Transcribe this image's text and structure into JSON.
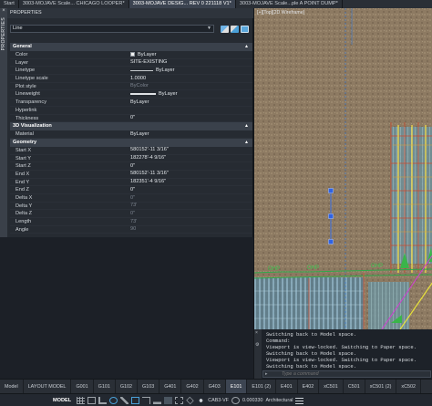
{
  "doc_tabs": [
    {
      "label": "Start",
      "active": false
    },
    {
      "label": "3003-MOJAVE Scale... CHICAGO LOOPER*",
      "active": false
    },
    {
      "label": "3003-MOJAVE DESIG... REV 0 221118 V1*",
      "active": true
    },
    {
      "label": "3003-MOJAVE Scale...ple A POINT DUMP*",
      "active": false
    }
  ],
  "palette": {
    "side_label": "PROPERTIES",
    "close_glyph": "×",
    "title": "PROPERTIES",
    "selection": "Line",
    "selection_icons": [
      "quick-select-icon",
      "select-objects-icon",
      "toggle-pickadd-icon"
    ],
    "sections": [
      {
        "name": "General",
        "rows": [
          {
            "key": "Color",
            "value": "ByLayer",
            "swatch": true
          },
          {
            "key": "Layer",
            "value": "SITE-EXISTING"
          },
          {
            "key": "Linetype",
            "value": "ByLayer",
            "line": "thin"
          },
          {
            "key": "Linetype scale",
            "value": "1.0000"
          },
          {
            "key": "Plot style",
            "value": "ByColor",
            "muted": true
          },
          {
            "key": "Lineweight",
            "value": "ByLayer",
            "line": "thick"
          },
          {
            "key": "Transparency",
            "value": "ByLayer"
          },
          {
            "key": "Hyperlink",
            "value": ""
          },
          {
            "key": "Thickness",
            "value": "0\""
          }
        ]
      },
      {
        "name": "3D Visualization",
        "rows": [
          {
            "key": "Material",
            "value": "ByLayer"
          }
        ]
      },
      {
        "name": "Geometry",
        "rows": [
          {
            "key": "Start X",
            "value": "580152'-11 3/16\""
          },
          {
            "key": "Start Y",
            "value": "182278'-4 9/16\""
          },
          {
            "key": "Start Z",
            "value": "0\""
          },
          {
            "key": "End X",
            "value": "580152'-11 3/16\""
          },
          {
            "key": "End Y",
            "value": "182351'-4 9/16\""
          },
          {
            "key": "End Z",
            "value": "0\""
          },
          {
            "key": "Delta X",
            "value": "0\"",
            "muted": true
          },
          {
            "key": "Delta Y",
            "value": "73'",
            "muted": true
          },
          {
            "key": "Delta Z",
            "value": "0\"",
            "muted": true
          },
          {
            "key": "Length",
            "value": "73'",
            "muted": true
          },
          {
            "key": "Angle",
            "value": "90",
            "muted": true
          }
        ]
      }
    ]
  },
  "viewport": {
    "label": "[+][Top][2D Wireframe]",
    "close_glyph": "×",
    "ohp_label": "OHP"
  },
  "command": {
    "side_glyphs": [
      "×",
      "🔧"
    ],
    "lines": [
      "Switching back to Model space.",
      "Command:",
      "Viewport is view-locked. Switching to Paper space.",
      "Switching back to Model space.",
      "Viewport is view-locked. Switching to Paper space.",
      "Switching back to Model space."
    ],
    "prompt_prefix": "▸",
    "placeholder": "Type a command"
  },
  "layout_tabs": [
    {
      "label": "Model",
      "active": false
    },
    {
      "label": "LAYOUT MODEL",
      "active": false
    },
    {
      "label": "G001",
      "active": false
    },
    {
      "label": "G101",
      "active": false
    },
    {
      "label": "G102",
      "active": false
    },
    {
      "label": "G103",
      "active": false
    },
    {
      "label": "G401",
      "active": false
    },
    {
      "label": "G402",
      "active": false
    },
    {
      "label": "G403",
      "active": false
    },
    {
      "label": "E101",
      "active": true
    },
    {
      "label": "E101 (2)",
      "active": false
    },
    {
      "label": "E401",
      "active": false
    },
    {
      "label": "E402",
      "active": false
    },
    {
      "label": "xC501",
      "active": false
    },
    {
      "label": "C501",
      "active": false
    },
    {
      "label": "xC501 (2)",
      "active": false
    },
    {
      "label": "xC502",
      "active": false
    }
  ],
  "status": {
    "model": "MODEL",
    "scale_label": "CAB3-VF",
    "coord_value": "0.000330",
    "units": "Architectural"
  }
}
